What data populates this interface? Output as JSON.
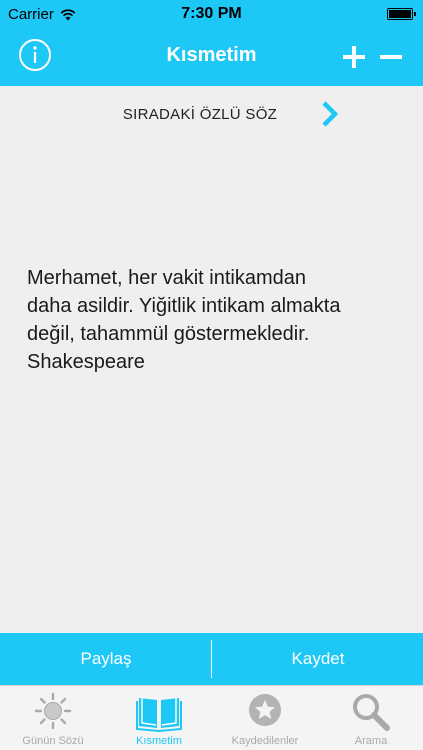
{
  "status_bar": {
    "carrier": "Carrier",
    "time": "7:30 PM",
    "wifi_icon": "wifi-icon",
    "battery_icon": "battery-icon"
  },
  "nav": {
    "title": "Kısmetim",
    "info_icon": "info-icon",
    "plus_icon": "plus-icon",
    "minus_icon": "minus-icon"
  },
  "content": {
    "next_label": "SIRADAKİ ÖZLÜ SÖZ",
    "next_icon": "chevron-right-icon",
    "quote_lines": [
      "Merhamet, her vakit intikamdan",
      "daha asildir. Yiğitlik intikam almakta",
      "değil, tahammül göstermekledir.",
      "Shakespeare"
    ]
  },
  "actions": {
    "share_label": "Paylaş",
    "save_label": "Kaydet"
  },
  "tabs": [
    {
      "label": "Günün Sözü",
      "icon": "sun-icon",
      "active": false
    },
    {
      "label": "Kısmetim",
      "icon": "book-icon",
      "active": true
    },
    {
      "label": "Kaydedilenler",
      "icon": "star-icon",
      "active": false
    },
    {
      "label": "Arama",
      "icon": "search-icon",
      "active": false
    }
  ],
  "colors": {
    "accent": "#1ec8f6",
    "background": "#efefef",
    "tab_inactive": "#a9a9a9"
  }
}
